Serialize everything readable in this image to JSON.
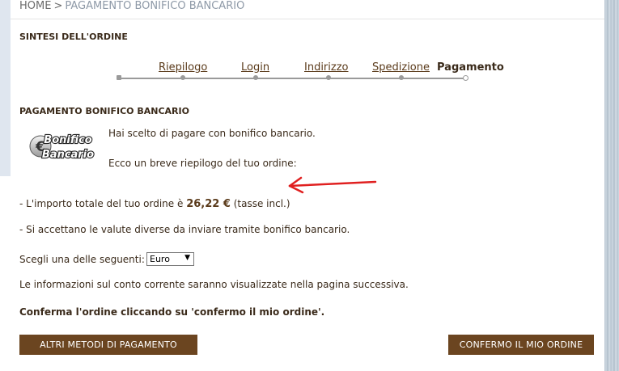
{
  "breadcrumb": {
    "home": "HOME",
    "separator": ">",
    "current": "PAGAMENTO BONIFICO BANCARIO"
  },
  "summary": {
    "title": "SINTESI DELL'ORDINE",
    "steps": [
      {
        "label": "Riepilogo",
        "state": "done"
      },
      {
        "label": "Login",
        "state": "done"
      },
      {
        "label": "Indirizzo",
        "state": "done"
      },
      {
        "label": "Spedizione",
        "state": "done"
      },
      {
        "label": "Pagamento",
        "state": "current"
      }
    ]
  },
  "payment": {
    "title": "PAGAMENTO BONIFICO BANCARIO",
    "logo_text_1": "Bonifico",
    "logo_text_2": "Bancario",
    "message_1": "Hai scelto di pagare con bonifico bancario.",
    "message_2": "Ecco un breve riepilogo del tuo ordine:",
    "total_prefix": "- L'importo totale del tuo ordine è",
    "total_amount": "26,22 €",
    "total_suffix": "(tasse incl.)",
    "currency_note": "- Si accettano le valute diverse da inviare tramite bonifico bancario.",
    "choose_label": "Scegli una delle seguenti:",
    "currency_selected": "Euro",
    "info_text": "Le informazioni sul conto corrente saranno visualizzate nella pagina successiva.",
    "confirm_text": "Conferma l'ordine cliccando su 'confermo il mio ordine'."
  },
  "buttons": {
    "other_methods": "ALTRI METODI DI PAGAMENTO",
    "confirm_order": "CONFERMO IL MIO ORDINE"
  },
  "colors": {
    "button_bg": "#6b4520",
    "arrow": "#e02020",
    "text": "#3a2a1a"
  }
}
